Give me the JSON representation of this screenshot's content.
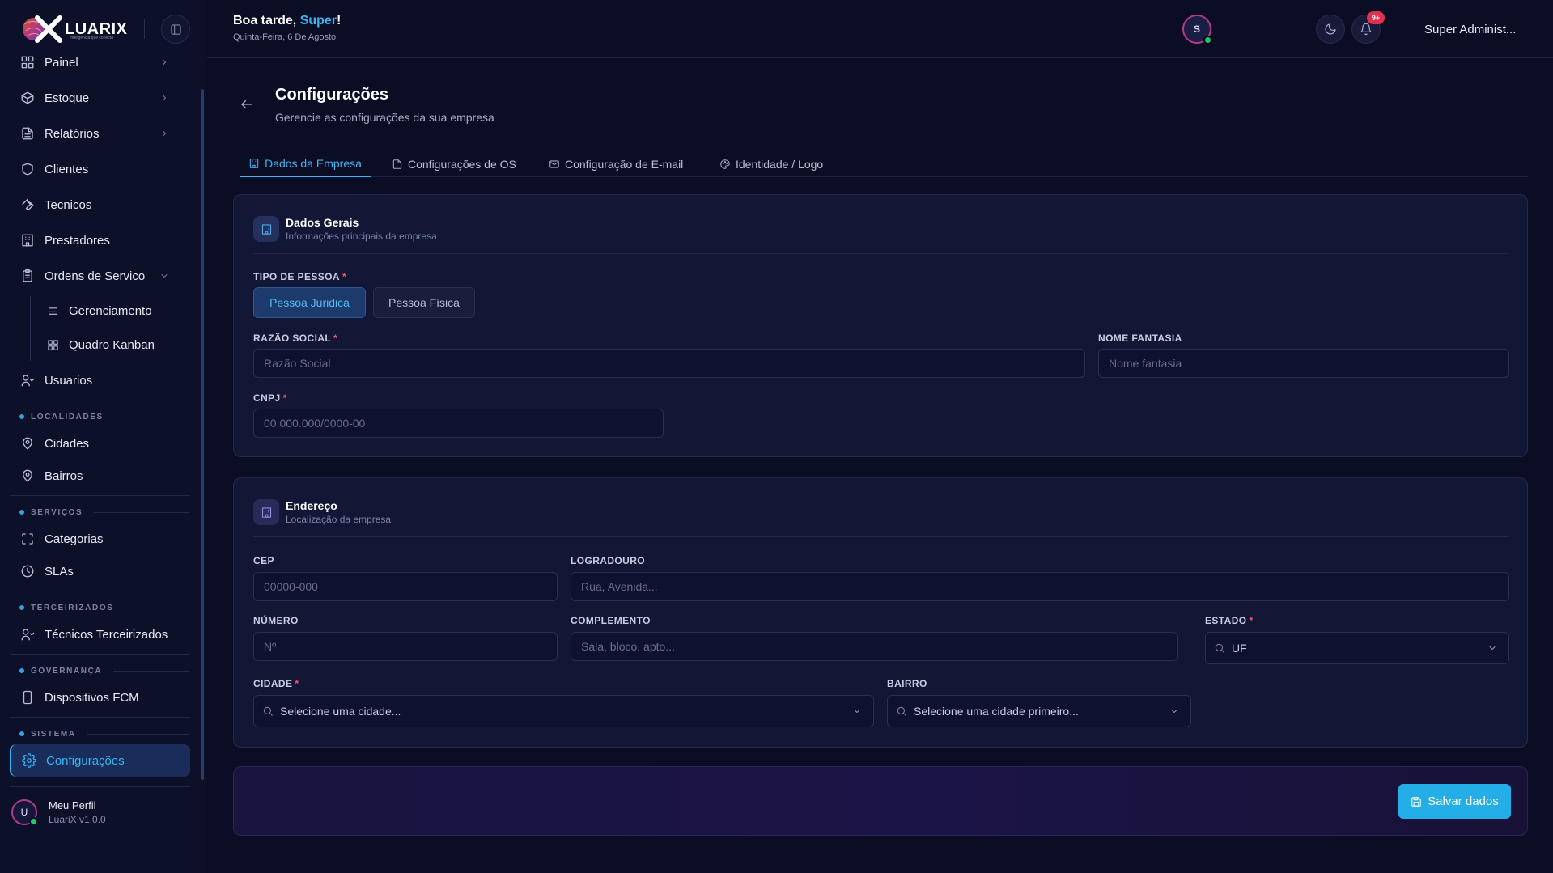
{
  "brand": {
    "name": "LUARIX",
    "tagline": "Inteligência que conecta"
  },
  "greeting": {
    "prefix": "Boa tarde, ",
    "name": "Super",
    "suffix": "!",
    "date": "Quinta-Feira, 6 De Agosto"
  },
  "topbar": {
    "notifications_badge": "9+",
    "user_initial": "S",
    "user_name": "Super Administ..."
  },
  "sidebar": {
    "items": [
      {
        "label": "Painel",
        "icon": "grid-icon"
      },
      {
        "label": "Estoque",
        "icon": "box-icon"
      },
      {
        "label": "Relatórios",
        "icon": "file-icon"
      },
      {
        "label": "Clientes",
        "icon": "shield-icon"
      },
      {
        "label": "Tecnicos",
        "icon": "wrench-icon"
      },
      {
        "label": "Prestadores",
        "icon": "building-icon"
      },
      {
        "label": "Ordens de Servico",
        "icon": "clipboard-icon"
      },
      {
        "label": "Gerenciamento",
        "icon": "list-icon"
      },
      {
        "label": "Quadro Kanban",
        "icon": "kanban-icon"
      },
      {
        "label": "Usuarios",
        "icon": "users-icon"
      }
    ],
    "sections": [
      {
        "title": "LOCALIDADES",
        "items": [
          {
            "label": "Cidades",
            "icon": "map-pin-icon"
          },
          {
            "label": "Bairros",
            "icon": "map-pin-icon"
          }
        ]
      },
      {
        "title": "SERVIÇOS",
        "items": [
          {
            "label": "Categorias",
            "icon": "scan-icon"
          },
          {
            "label": "SLAs",
            "icon": "clock-icon"
          }
        ]
      },
      {
        "title": "TERCEIRIZADOS",
        "items": [
          {
            "label": "Técnicos Terceirizados",
            "icon": "users-icon"
          }
        ]
      },
      {
        "title": "GOVERNANÇA",
        "items": [
          {
            "label": "Dispositivos FCM",
            "icon": "smartphone-icon"
          }
        ]
      },
      {
        "title": "SISTEMA",
        "items": [
          {
            "label": "Configurações",
            "icon": "gear-icon"
          }
        ]
      }
    ],
    "profile": {
      "initial": "U",
      "name": "Meu Perfil",
      "version": "LuariX v1.0.0"
    }
  },
  "page": {
    "title": "Configurações",
    "subtitle": "Gerencie as configurações da sua empresa",
    "tabs": [
      {
        "label": "Dados da Empresa",
        "active": true
      },
      {
        "label": "Configurações de OS",
        "active": false
      },
      {
        "label": "Configuração de E-mail",
        "active": false
      },
      {
        "label": "Identidade / Logo",
        "active": false
      }
    ]
  },
  "dados_gerais": {
    "title": "Dados Gerais",
    "subtitle": "Informações principais da empresa",
    "tipo_label": "TIPO DE PESSOA",
    "tipo_options": [
      "Pessoa Juridica",
      "Pessoa Física"
    ],
    "tipo_selected": "Pessoa Juridica",
    "razao_label": "RAZÃO SOCIAL",
    "razao_placeholder": "Razão Social",
    "fantasia_label": "NOME FANTASIA",
    "fantasia_placeholder": "Nome fantasia",
    "cnpj_label": "CNPJ",
    "cnpj_placeholder": "00.000.000/0000-00"
  },
  "endereco": {
    "title": "Endereço",
    "subtitle": "Localização da empresa",
    "cep_label": "CEP",
    "cep_placeholder": "00000-000",
    "logradouro_label": "LOGRADOURO",
    "logradouro_placeholder": "Rua, Avenida...",
    "numero_label": "NÚMERO",
    "numero_placeholder": "Nº",
    "complemento_label": "COMPLEMENTO",
    "complemento_placeholder": "Sala, bloco, apto...",
    "estado_label": "ESTADO",
    "estado_value": "UF",
    "cidade_label": "CIDADE",
    "cidade_value": "Selecione uma cidade...",
    "bairro_label": "BAIRRO",
    "bairro_value": "Selecione uma cidade primeiro..."
  },
  "footer": {
    "save_label": "Salvar dados"
  },
  "colors": {
    "accent": "#3fb5f3",
    "background": "#0b0d24",
    "card": "#131736",
    "required": "#f0566f",
    "badge": "#e2304f",
    "online": "#22c55e"
  }
}
